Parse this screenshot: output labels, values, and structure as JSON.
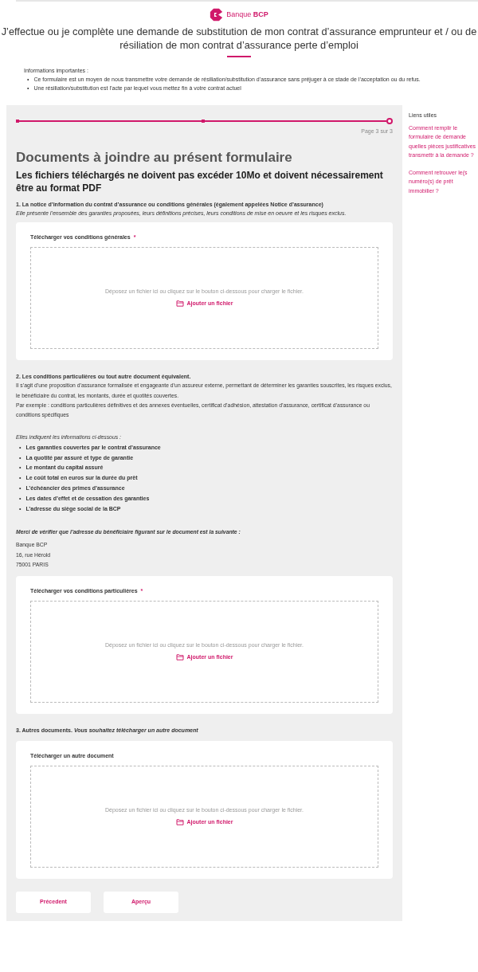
{
  "logo": {
    "text": "Banque **BCP**"
  },
  "title": "J’effectue ou je complète une demande de substitution de mon contrat d’assurance emprunteur et / ou de résiliation de mon contrat d’assurance perte d’emploi",
  "bullet": "•",
  "info": {
    "heading": "Informations importantes :",
    "items": [
      "Ce formulaire est un moyen de nous transmettre votre demande de résiliation/substitution d’assurance sans préjuger à ce stade de l’acceptation ou du refus.",
      "Une résiliation/substitution est l’acte par lequel vous mettez fin à votre contrat actuel"
    ]
  },
  "steps": [
    {
      "current": false
    },
    {
      "current": false
    },
    {
      "current": true
    }
  ],
  "page_indicator": "Page 3 sur 3",
  "heading": "Documents à joindre au présent formulaire",
  "subheading": "Les fichiers téléchargés ne doivent pas excéder 10Mo et doivent nécessairement être au format PDF",
  "section1": {
    "title": "1. La notice d’information du contrat d’assurance ou conditions générales (également appelées Notice d’assurance)",
    "description": "Elle présente l’ensemble des garanties proposées, leurs définitions précises, leurs conditions de mise en oeuvre et les risques exclus."
  },
  "section2": {
    "title": "2. Les conditions particulières ou tout autre document équivalent.",
    "paragraphs": [
      "Il s’agit d’une proposition d’assurance formalisée et engageante d’un assureur externe, permettant de déterminer les garanties souscrites, les risques exclus, le bénéficiaire du contrat, les montants, durée et quotités couvertes.",
      "Par exemple : conditions particulières définitives et des annexes éventuelles, certificat d’adhésion, attestation d’assurance, certificat d’assurance ou conditions spécifiques"
    ],
    "list_intro": "Elles indiquent les informations ci-dessous :",
    "items": [
      "Les garanties couvertes par le contrat d’assurance",
      "La quotité par assuré et type de garantie",
      "Le montant du capital assuré",
      "Le coût total en euros sur la durée du prêt",
      "L’échéancier des primes d’assurance",
      "Les dates d’effet et de cessation des garanties",
      "L’adresse du siège social de la BCP"
    ],
    "verify_note": "Merci de vérifier que l’adresse du bénéficiaire figurant sur le document est la suivante :",
    "address": [
      "Banque BCP",
      "16, rue Hérold",
      "75001 PARIS"
    ]
  },
  "section3": {
    "title": "**3. Autres documents.** *Vous souhaitez télécharger un autre document*"
  },
  "uploads": [
    {
      "label": "Télécharger vos conditions générales",
      "required": true,
      "required_mark": "*",
      "hint": "Déposez un fichier ici ou cliquez sur le bouton ci-dessous pour charger le fichier.",
      "button": "Ajouter un fichier"
    },
    {
      "label": "Télécharger vos conditions particulières",
      "required": true,
      "required_mark": "*",
      "hint": "Déposez un fichier ici ou cliquez sur le bouton ci-dessous pour charger le fichier.",
      "button": "Ajouter un fichier"
    },
    {
      "label": "Télécharger un autre document",
      "required": false,
      "hint": "Déposez un fichier ici ou cliquez sur le bouton ci-dessous pour charger le fichier.",
      "button": "Ajouter un fichier"
    }
  ],
  "buttons": [
    "Précedent",
    "Aperçu"
  ],
  "sidebar": {
    "title": "Liens utiles",
    "links": [
      "Comment remplir le formulaire de demande quelles pièces justificatives transmettr à la demande ?",
      "Comment retrouver le(s numéro(s) de prêt immobilier ?"
    ]
  }
}
